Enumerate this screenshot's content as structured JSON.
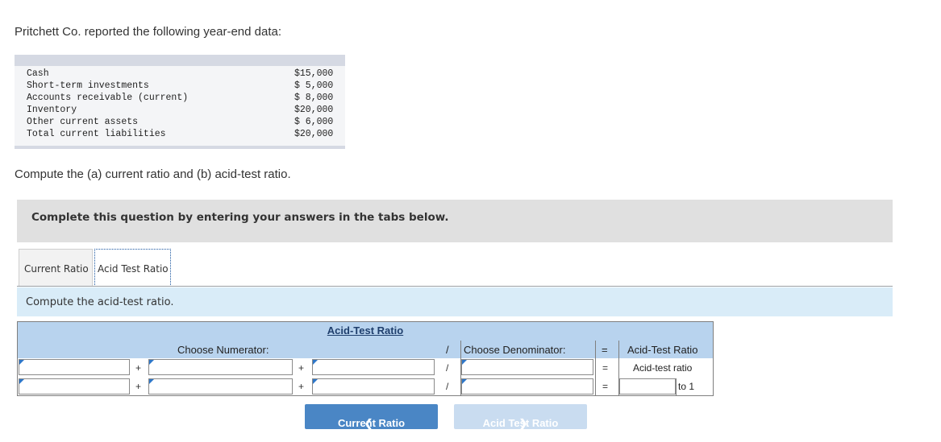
{
  "intro": "Pritchett Co. reported the following year-end data:",
  "data_rows": [
    {
      "label": "Cash",
      "amount": "$15,000"
    },
    {
      "label": "Short-term investments",
      "amount": "$ 5,000"
    },
    {
      "label": "Accounts receivable (current)",
      "amount": "$ 8,000"
    },
    {
      "label": "Inventory",
      "amount": "$20,000"
    },
    {
      "label": "Other current assets",
      "amount": "$ 6,000"
    },
    {
      "label": "Total current liabilities",
      "amount": "$20,000"
    }
  ],
  "prompt": "Compute the (a) current ratio and (b) acid-test ratio.",
  "banner": "Complete this question by entering your answers in the tabs below.",
  "tabs": [
    "Current Ratio",
    "Acid Test Ratio"
  ],
  "instruction": "Compute the acid-test ratio.",
  "grid": {
    "title": "Acid-Test Ratio",
    "numerator_header": "Choose Numerator:",
    "divider": "/",
    "denominator_header": "Choose Denominator:",
    "equals": "=",
    "result_header": "Acid-Test Ratio",
    "plus": "+",
    "row1_result": "Acid-test ratio",
    "row2_result_suffix": "to 1"
  },
  "nav": {
    "prev": "Current Ratio",
    "next": "Acid Test Ratio"
  },
  "colors": {
    "accent": "#4a86c5",
    "header": "#b8d3ee",
    "instruction_bg": "#d9ecf8"
  }
}
